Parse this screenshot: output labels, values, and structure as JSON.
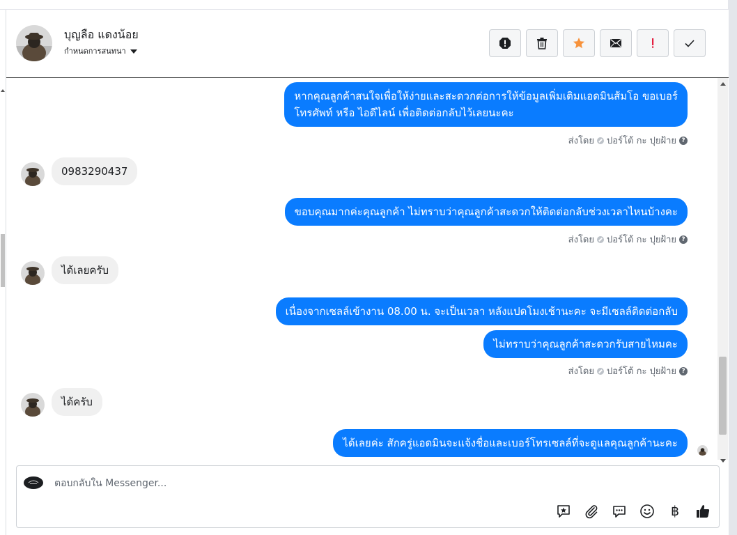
{
  "header": {
    "contact_name": "บุญลือ แดงน้อย",
    "assign_label": "กำหนดการสนทนา"
  },
  "actions": [
    {
      "name": "report-button",
      "icon": "alert-octagon-icon"
    },
    {
      "name": "delete-button",
      "icon": "trash-icon"
    },
    {
      "name": "star-button",
      "icon": "star-icon"
    },
    {
      "name": "mark-unread-button",
      "icon": "envelope-icon"
    },
    {
      "name": "flag-important-button",
      "icon": "exclamation-icon"
    },
    {
      "name": "mark-done-button",
      "icon": "check-icon"
    }
  ],
  "colors": {
    "outgoing": "#0a7cff",
    "incoming": "#f0f0f0",
    "star": "#f7923b",
    "exclamation": "#e41e3f"
  },
  "messages": [
    {
      "dir": "out",
      "lines": [
        "หากคุณลูกค้าสนใจเพื่อให้ง่ายและสะดวกต่อการให้ข้อมูลเพิ่มเติมแอดมินส้มโอ ขอเบอร์",
        "โทรศัพท์ หรือ ไอดีไลน์ เพื่อติดต่อกลับไว้เลยนะคะ"
      ]
    },
    {
      "dir": "in",
      "text": "0983290437"
    },
    {
      "dir": "out",
      "text": "ขอบคุณมากค่ะคุณลูกค้า ไม่ทราบว่าคุณลูกค้าสะดวกให้ติดต่อกลับช่วงเวลาไหนบ้างคะ"
    },
    {
      "dir": "in",
      "text": "ได้เลยครับ"
    },
    {
      "dir": "out",
      "text": "เนื่องจากเซลล์เข้างาน 08.00 น. จะเป็นเวลา หลังแปดโมงเช้านะคะ จะมีเซลล์ติดต่อกลับ"
    },
    {
      "dir": "out",
      "text": "ไม่ทราบว่าคุณลูกค้าสะดวกรับสายไหมคะ"
    },
    {
      "dir": "in",
      "text": "ได้ครับ"
    },
    {
      "dir": "out",
      "text": "ได้เลยค่ะ สักครู่แอดมินจะแจ้งชื่อและเบอร์โทรเซลล์ที่จะดูแลคุณลูกค้านะคะ"
    }
  ],
  "sent_by": {
    "prefix": "ส่งโดย",
    "agent": "ปอร์โต้ กะ ปุยฝ้าย"
  },
  "composer": {
    "placeholder": "ตอบกลับใน Messenger...",
    "tools": [
      "saved-reply-icon",
      "attachment-icon",
      "chat-bubble-icon",
      "emoji-icon",
      "baht-icon",
      "thumbs-up-icon"
    ],
    "baht_symbol": "฿"
  }
}
